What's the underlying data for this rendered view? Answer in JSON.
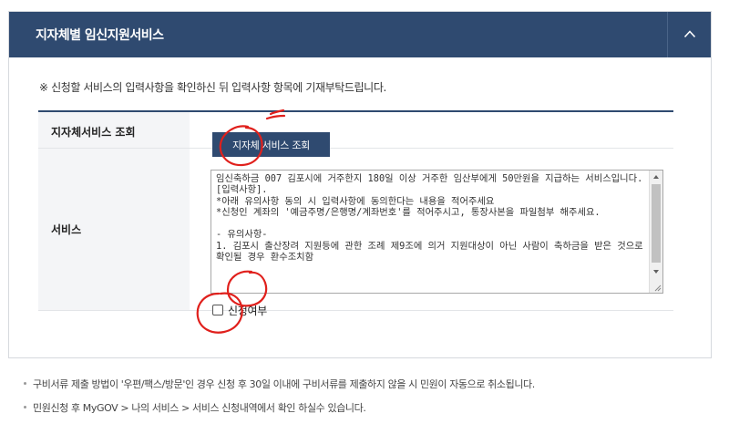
{
  "panel": {
    "title": "지자체별 임신지원서비스",
    "collapse_icon": "chevron-up-icon"
  },
  "notice": "※ 신청할 서비스의 입력사항을 확인하신 뒤 입력사항 항목에 기재부탁드립니다.",
  "lookup": {
    "label": "지자체서비스 조회",
    "button_label": "지자체 서비스 조회"
  },
  "service": {
    "label": "서비스",
    "content_lines": [
      "임신축하금 007 김포시에 거주한지 180일 이상 거주한 임산부에게 50만원을 지급하는 서비스입니다.",
      "[입력사항].",
      "*아래 유의사항 동의 시 입력사항에 동의한다는 내용을 적어주세요",
      "*신청인 계좌의 '예금주명/은행명/계좌번호'를 적어주시고, 통장사본을 파일첨부 해주세요.",
      "",
      "- 유의사항-",
      "1. 김포시 출산장려 지원등에 관한 조례 제9조에 의거 지원대상이 아닌 사람이 축하금을 받은 것으로 확인될 경우 환수조치함"
    ],
    "agree_label": "신청여부",
    "agree_checked": false
  },
  "footnotes": [
    "구비서류 제출 방법이 '우편/팩스/방문'인 경우 신청 후 30일 이내에 구비서류를 제출하지 않을 시 민원이 자동으로 취소됩니다.",
    "민원신청 후 MyGOV > 나의 서비스 > 서비스 신청내역에서 확인 하실수 있습니다."
  ],
  "colors": {
    "header_bg": "#2f4a70",
    "annotation_red": "#e0201c"
  }
}
